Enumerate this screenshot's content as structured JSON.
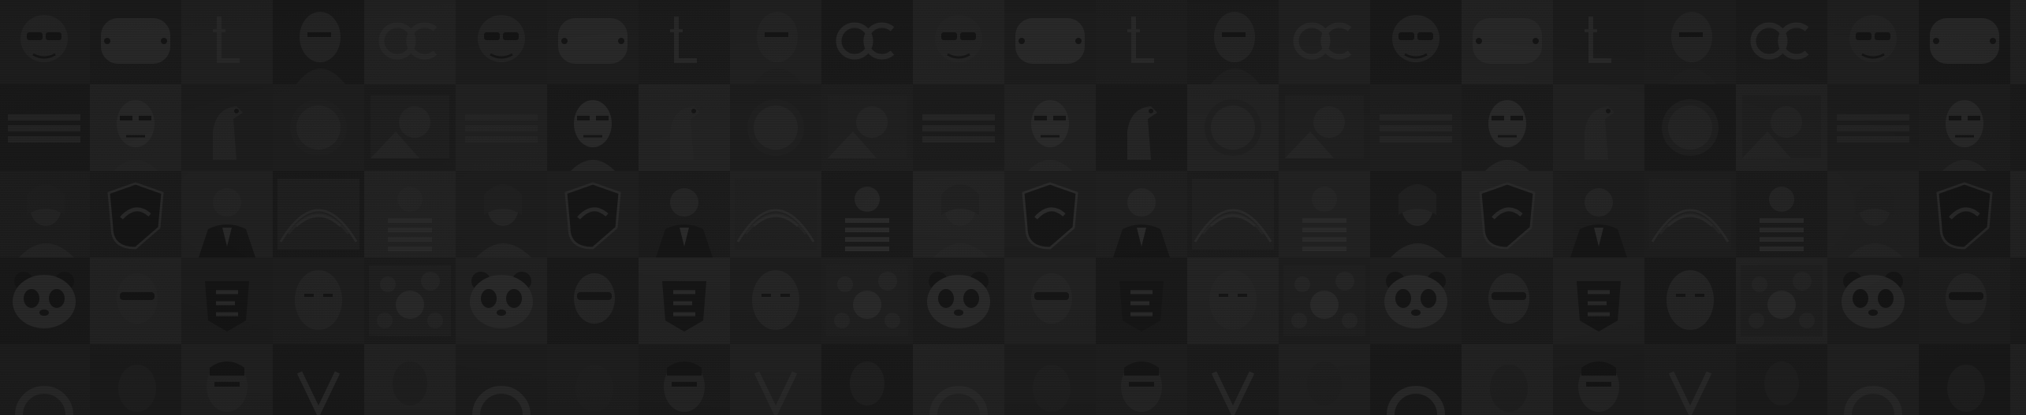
{
  "background": {
    "base_color": "#1b1b1b",
    "tile_colors": [
      "#2a2a2a",
      "#242424",
      "#303030",
      "#1f1f1f",
      "#343434",
      "#272727"
    ],
    "pattern": [
      [
        "face-sunglasses-icon",
        "rounded-badge-icon",
        "letter-l-icon",
        "face-portrait-icon",
        "infinity-logo-icon"
      ],
      [
        "bars-logo-icon",
        "cartoon-face-icon",
        "horse-figure-icon",
        "round-portrait-icon",
        "photo-collage-icon"
      ],
      [
        "woman-portrait-icon",
        "shield-logo-icon",
        "man-suit-icon",
        "ornate-pattern-icon",
        "striped-shirt-icon"
      ],
      [
        "panda-icon",
        "dark-glasses-icon",
        "e-shield-logo-icon",
        "man-face-icon",
        "floral-photo-icon"
      ],
      [
        "arc-logo-icon",
        "dark-portrait-icon",
        "bearded-face-icon",
        "v-logo-icon",
        "dim-portrait-icon"
      ]
    ]
  }
}
